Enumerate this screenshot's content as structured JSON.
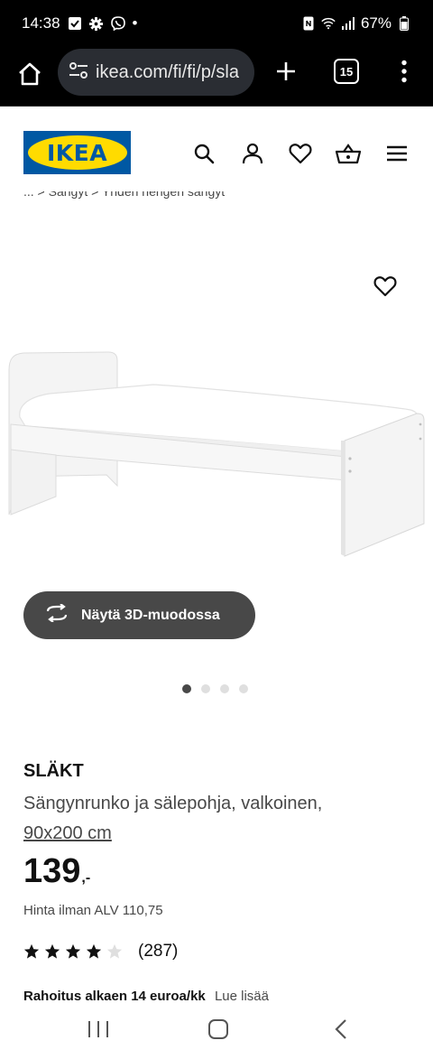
{
  "status_bar": {
    "time": "14:38",
    "dot": "•",
    "battery": "67%",
    "icons": [
      "check-icon",
      "gear-icon",
      "viber-icon",
      "nfc-icon",
      "wifi-icon",
      "signal-icon",
      "battery-icon"
    ]
  },
  "browser": {
    "url": "ikea.com/fi/fi/p/sla",
    "tab_count": "15",
    "icons": [
      "home-icon",
      "site-settings-icon",
      "plus-icon",
      "tabs-icon",
      "more-menu-icon"
    ]
  },
  "header": {
    "logo_text": "IKEA",
    "icons": [
      "search-icon",
      "profile-icon",
      "heart-icon",
      "basket-icon",
      "hamburger-menu-icon"
    ]
  },
  "breadcrumb": {
    "text": "...   >   Sängyt   >   Yhden hengen sängyt"
  },
  "gallery": {
    "view_3d_label": "Näytä 3D-muodossa",
    "slide_count": 4,
    "active_slide": 1
  },
  "product": {
    "name": "SLÄKT",
    "description": "Sängynrunko ja sälepohja, valkoinen,",
    "size": "90x200 cm",
    "price_int": "139",
    "price_dec": ",-",
    "vat_text": "Hinta ilman ALV 110,75",
    "rating_stars": 4,
    "rating_max": 5,
    "review_count": "(287)",
    "financing_text": "Rahoitus alkaen 14 euroa/kk",
    "financing_link": "Lue lisää"
  },
  "colors": {
    "ikea_blue": "#0058a3",
    "ikea_yellow": "#ffdb00",
    "button_dark": "#484848"
  }
}
